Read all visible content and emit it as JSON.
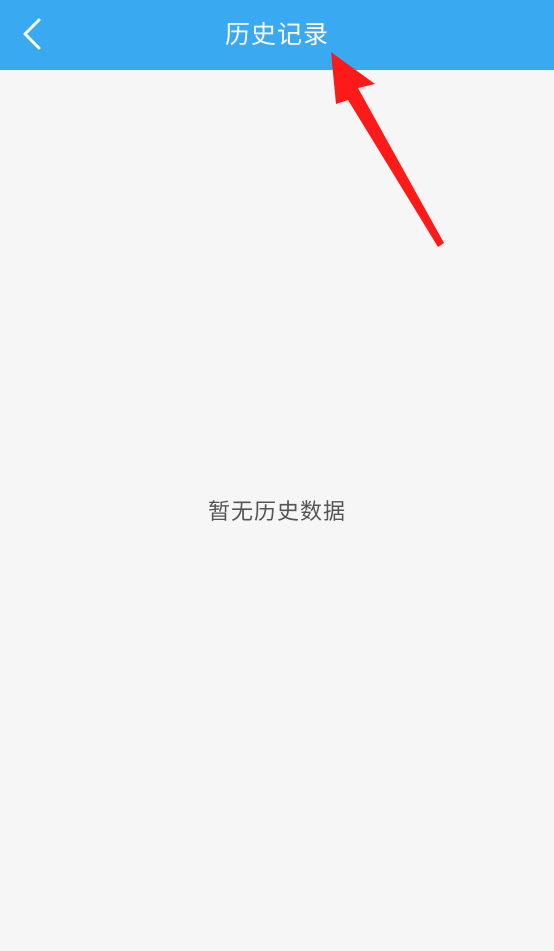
{
  "header": {
    "title": "历史记录",
    "back_icon": "chevron-left-icon",
    "background_color": "#39a9f2"
  },
  "main": {
    "empty_message": "暂无历史数据"
  },
  "annotation": {
    "arrow_color": "#ff1a1a"
  }
}
